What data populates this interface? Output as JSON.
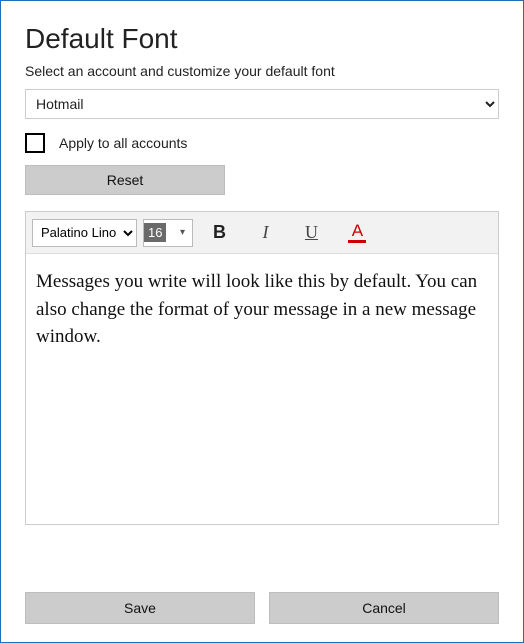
{
  "title": "Default Font",
  "subtitle": "Select an account and customize your default font",
  "account": {
    "selected": "Hotmail"
  },
  "apply_all": {
    "label": "Apply to all accounts",
    "checked": false
  },
  "reset_label": "Reset",
  "toolbar": {
    "font_family": "Palatino Lino",
    "font_size": "16",
    "bold_glyph": "B",
    "italic_glyph": "I",
    "underline_glyph": "U",
    "color_glyph": "A",
    "font_color": "#cc0000"
  },
  "preview_text": "Messages you write will look like this by default. You can also change the format of your message in a new message window.",
  "footer": {
    "save_label": "Save",
    "cancel_label": "Cancel"
  }
}
